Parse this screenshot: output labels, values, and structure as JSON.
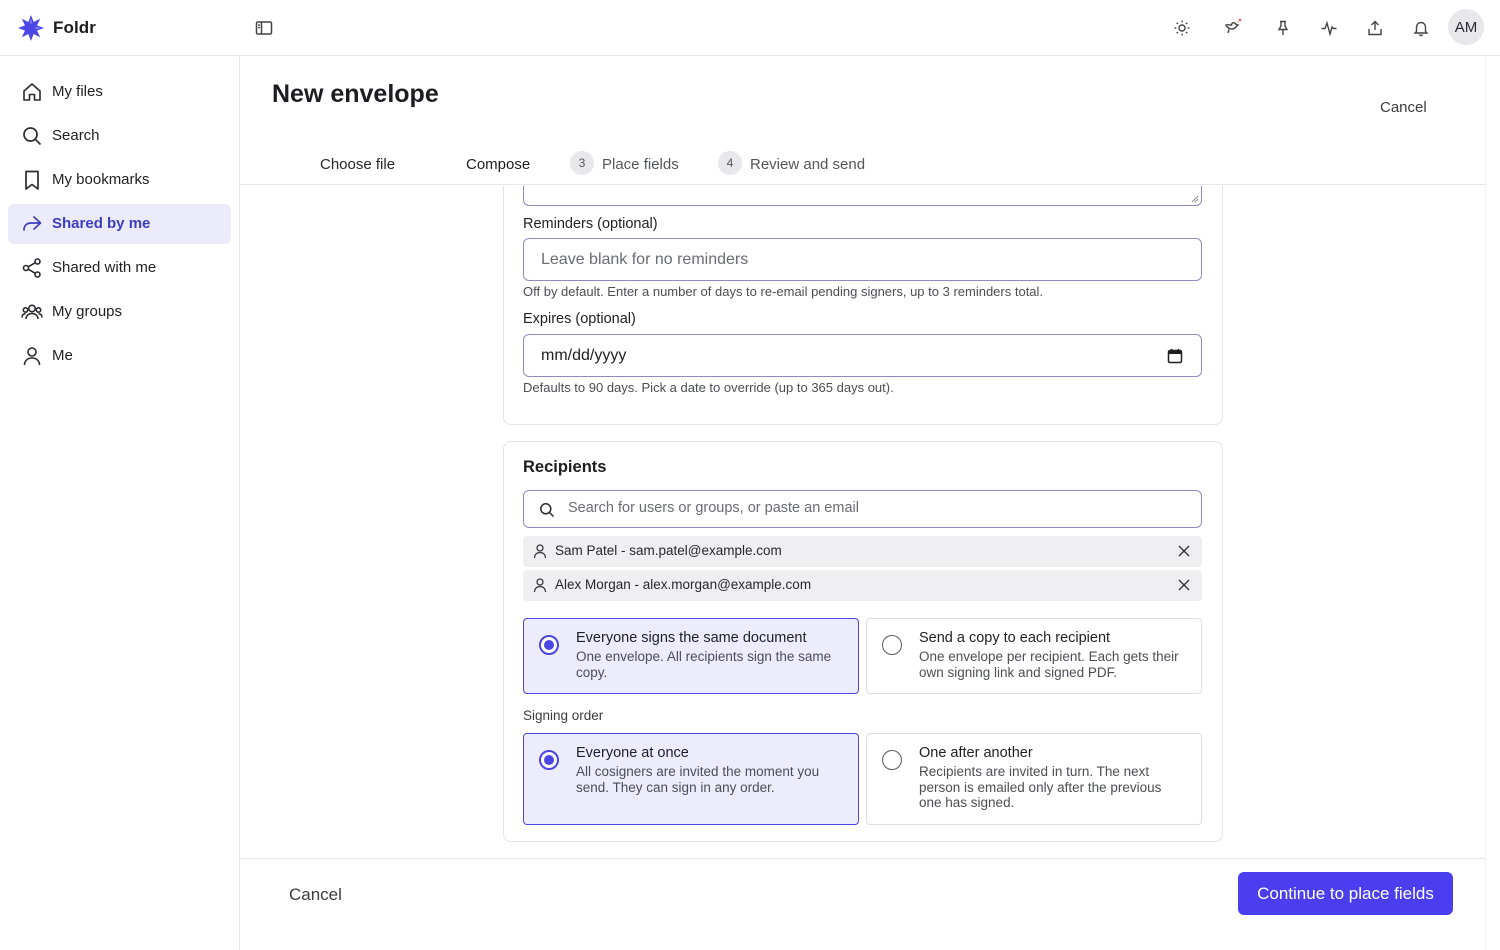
{
  "app": {
    "name": "Foldr",
    "avatar_initials": "AM",
    "accent": "#4a3ef0"
  },
  "topbar": {
    "icons": [
      "sidebar-toggle-icon",
      "sun-icon",
      "bird-icon",
      "pin-icon",
      "activity-icon",
      "upload-icon",
      "bell-icon"
    ]
  },
  "sidebar": {
    "items": [
      {
        "label": "My files",
        "icon": "home-icon",
        "active": false
      },
      {
        "label": "Search",
        "icon": "search-icon",
        "active": false
      },
      {
        "label": "My bookmarks",
        "icon": "bookmark-icon",
        "active": false
      },
      {
        "label": "Shared by me",
        "icon": "share-forward-icon",
        "active": true
      },
      {
        "label": "Shared with me",
        "icon": "share-nodes-icon",
        "active": false
      },
      {
        "label": "My groups",
        "icon": "users-icon",
        "active": false
      },
      {
        "label": "Me",
        "icon": "user-icon",
        "active": false
      }
    ]
  },
  "header": {
    "title": "New envelope",
    "cancel": "Cancel",
    "steps": [
      {
        "label": "Choose file",
        "number": ""
      },
      {
        "label": "Compose",
        "number": ""
      },
      {
        "number": "3",
        "label": "Place fields"
      },
      {
        "number": "4",
        "label": "Review and send"
      }
    ]
  },
  "reminders": {
    "label": "Reminders (optional)",
    "placeholder": "Leave blank for no reminders",
    "help": "Off by default. Enter a number of days to re-email pending signers, up to 3 reminders total."
  },
  "expires": {
    "label": "Expires (optional)",
    "value": "mm/dd/yyyy",
    "help": "Defaults to 90 days. Pick a date to override (up to 365 days out)."
  },
  "recipients": {
    "title": "Recipients",
    "search_placeholder": "Search for users or groups, or paste an email",
    "list": [
      "Sam Patel - sam.patel@example.com",
      "Alex Morgan - alex.morgan@example.com"
    ],
    "mode_options": [
      {
        "title": "Everyone signs the same document",
        "desc": "One envelope. All recipients sign the same copy.",
        "selected": true
      },
      {
        "title": "Send a copy to each recipient",
        "desc": "One envelope per recipient. Each gets their own signing link and signed PDF.",
        "selected": false
      }
    ],
    "signing_order_label": "Signing order",
    "order_options": [
      {
        "title": "Everyone at once",
        "desc": "All cosigners are invited the moment you send. They can sign in any order.",
        "selected": true
      },
      {
        "title": "One after another",
        "desc": "Recipients are invited in turn. The next person is emailed only after the previous one has signed.",
        "selected": false
      }
    ]
  },
  "footer": {
    "cancel": "Cancel",
    "continue": "Continue to place fields"
  }
}
